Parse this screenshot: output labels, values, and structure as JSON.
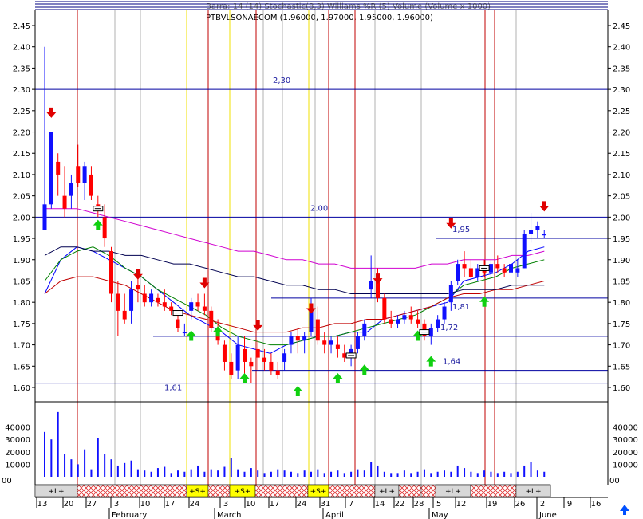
{
  "header": {
    "title": "PTBVLSONAECOM (1.96000, 1.97000, 1.95000, 1.96000)",
    "overlay_text": "Barra: 14 (14) Stochastic(8,3) Williams %R (5) Volume (Volume x 1000)"
  },
  "colors": {
    "bull_candle": "#1010ff",
    "bear_candle": "#ff0000",
    "vline_red": "#c00000",
    "vline_yellow": "#f0e000",
    "vline_gray": "#b0b0b0",
    "hline": "#0000a0",
    "ma_blue": "#0000ff",
    "ma_green": "#008000",
    "ma_red": "#c00000",
    "ma_navy": "#000050",
    "ma_magenta": "#d000d0",
    "arrow_up": "#10d010",
    "arrow_down": "#e00000",
    "signal_yellow": "#ffff00",
    "signal_hatch": "#e03030",
    "nav_arrow": "#0050ff"
  },
  "nav_icon": "arrow-up-icon",
  "chart_data": {
    "type": "candlestick",
    "price_axis": {
      "ylim": [
        1.6,
        2.45
      ],
      "ticks": [
        "1.60",
        "1.65",
        "1.70",
        "1.75",
        "1.80",
        "1.85",
        "1.90",
        "1.95",
        "2.00",
        "2.05",
        "2.10",
        "2.15",
        "2.20",
        "2.25",
        "2.30",
        "2.35",
        "2.40",
        "2.45"
      ]
    },
    "volume_axis": {
      "ticks": [
        "10000",
        "20000",
        "30000",
        "40000"
      ],
      "ylim": [
        0,
        50000
      ]
    },
    "volume_corner_label": "00",
    "x_day_ticks": [
      "13",
      "20",
      "27",
      "3",
      "10",
      "17",
      "24",
      "3",
      "10",
      "17",
      "24",
      "31",
      "7",
      "14",
      "22",
      "28",
      "5",
      "12",
      "19",
      "26",
      "2",
      "9",
      "16"
    ],
    "months": [
      "February",
      "March",
      "April",
      "May",
      "June"
    ],
    "annotations": [
      {
        "text": "2,30",
        "price": 2.3
      },
      {
        "text": "2.00",
        "price": 2.0
      },
      {
        "text": "1,95",
        "price": 1.95
      },
      {
        "text": "1,81",
        "price": 1.81
      },
      {
        "text": "1,72",
        "price": 1.72
      },
      {
        "text": "1,64",
        "price": 1.64
      },
      {
        "text": "1,61",
        "price": 1.61
      }
    ],
    "horizontal_levels": [
      2.3,
      2.0,
      1.95,
      1.85,
      1.81,
      1.72,
      1.64,
      1.61
    ],
    "candles": [
      [
        1.97,
        2.4,
        1.97,
        2.03
      ],
      [
        2.03,
        2.2,
        2.02,
        2.2
      ],
      [
        2.13,
        2.15,
        2.05,
        2.1
      ],
      [
        2.05,
        2.12,
        2.0,
        2.02
      ],
      [
        2.05,
        2.1,
        2.02,
        2.08
      ],
      [
        2.12,
        2.17,
        2.07,
        2.08
      ],
      [
        2.08,
        2.13,
        2.04,
        2.12
      ],
      [
        2.1,
        2.12,
        2.04,
        2.05
      ],
      [
        2.03,
        2.05,
        2.0,
        2.02
      ],
      [
        2.0,
        2.03,
        1.93,
        1.95
      ],
      [
        1.92,
        1.93,
        1.8,
        1.82
      ],
      [
        1.82,
        1.85,
        1.72,
        1.78
      ],
      [
        1.78,
        1.82,
        1.75,
        1.76
      ],
      [
        1.78,
        1.85,
        1.75,
        1.83
      ],
      [
        1.84,
        1.87,
        1.8,
        1.83
      ],
      [
        1.82,
        1.84,
        1.79,
        1.8
      ],
      [
        1.8,
        1.83,
        1.79,
        1.82
      ],
      [
        1.81,
        1.82,
        1.79,
        1.8
      ],
      [
        1.8,
        1.83,
        1.78,
        1.79
      ],
      [
        1.79,
        1.8,
        1.77,
        1.78
      ],
      [
        1.76,
        1.78,
        1.73,
        1.74
      ],
      [
        1.73,
        1.75,
        1.72,
        1.73
      ],
      [
        1.78,
        1.81,
        1.76,
        1.8
      ],
      [
        1.8,
        1.82,
        1.78,
        1.79
      ],
      [
        1.79,
        1.82,
        1.77,
        1.78
      ],
      [
        1.78,
        1.79,
        1.73,
        1.74
      ],
      [
        1.74,
        1.76,
        1.7,
        1.71
      ],
      [
        1.7,
        1.71,
        1.64,
        1.66
      ],
      [
        1.66,
        1.68,
        1.62,
        1.63
      ],
      [
        1.64,
        1.72,
        1.62,
        1.7
      ],
      [
        1.69,
        1.72,
        1.63,
        1.66
      ],
      [
        1.66,
        1.67,
        1.61,
        1.65
      ],
      [
        1.69,
        1.71,
        1.64,
        1.67
      ],
      [
        1.67,
        1.69,
        1.64,
        1.66
      ],
      [
        1.66,
        1.68,
        1.63,
        1.64
      ],
      [
        1.64,
        1.66,
        1.62,
        1.63
      ],
      [
        1.66,
        1.69,
        1.64,
        1.68
      ],
      [
        1.7,
        1.73,
        1.68,
        1.72
      ],
      [
        1.72,
        1.74,
        1.68,
        1.71
      ],
      [
        1.71,
        1.73,
        1.68,
        1.72
      ],
      [
        1.73,
        1.81,
        1.72,
        1.78
      ],
      [
        1.76,
        1.79,
        1.7,
        1.71
      ],
      [
        1.71,
        1.73,
        1.68,
        1.7
      ],
      [
        1.7,
        1.72,
        1.68,
        1.71
      ],
      [
        1.7,
        1.72,
        1.67,
        1.69
      ],
      [
        1.68,
        1.7,
        1.66,
        1.67
      ],
      [
        1.67,
        1.7,
        1.65,
        1.69
      ],
      [
        1.69,
        1.73,
        1.68,
        1.72
      ],
      [
        1.72,
        1.76,
        1.71,
        1.75
      ],
      [
        1.83,
        1.91,
        1.81,
        1.85
      ],
      [
        1.85,
        1.88,
        1.8,
        1.81
      ],
      [
        1.81,
        1.82,
        1.75,
        1.76
      ],
      [
        1.76,
        1.78,
        1.74,
        1.75
      ],
      [
        1.75,
        1.77,
        1.74,
        1.76
      ],
      [
        1.76,
        1.78,
        1.75,
        1.77
      ],
      [
        1.77,
        1.79,
        1.75,
        1.76
      ],
      [
        1.76,
        1.78,
        1.74,
        1.75
      ],
      [
        1.75,
        1.76,
        1.71,
        1.72
      ],
      [
        1.72,
        1.75,
        1.7,
        1.74
      ],
      [
        1.74,
        1.77,
        1.73,
        1.76
      ],
      [
        1.76,
        1.8,
        1.75,
        1.79
      ],
      [
        1.8,
        1.85,
        1.78,
        1.84
      ],
      [
        1.85,
        1.9,
        1.84,
        1.89
      ],
      [
        1.89,
        1.92,
        1.86,
        1.88
      ],
      [
        1.88,
        1.9,
        1.85,
        1.86
      ],
      [
        1.86,
        1.89,
        1.85,
        1.88
      ],
      [
        1.88,
        1.9,
        1.86,
        1.87
      ],
      [
        1.87,
        1.9,
        1.86,
        1.89
      ],
      [
        1.89,
        1.91,
        1.87,
        1.88
      ],
      [
        1.88,
        1.89,
        1.86,
        1.87
      ],
      [
        1.87,
        1.9,
        1.86,
        1.89
      ],
      [
        1.87,
        1.9,
        1.86,
        1.88
      ],
      [
        1.88,
        1.97,
        1.88,
        1.96
      ],
      [
        1.96,
        2.01,
        1.94,
        1.97
      ],
      [
        1.97,
        1.99,
        1.95,
        1.98
      ],
      [
        1.96,
        1.97,
        1.95,
        1.96
      ]
    ],
    "volumes": [
      36000,
      30000,
      52000,
      18000,
      14000,
      10000,
      22000,
      6000,
      31000,
      18000,
      14000,
      9000,
      11000,
      13000,
      6000,
      5000,
      4000,
      7000,
      8000,
      3000,
      5000,
      4000,
      6000,
      9000,
      4000,
      6000,
      5000,
      8000,
      15000,
      6000,
      4000,
      7000,
      5000,
      3000,
      4000,
      6000,
      5000,
      4000,
      3000,
      5000,
      4000,
      6000,
      3000,
      4000,
      5000,
      3000,
      4000,
      6000,
      5000,
      12000,
      9000,
      4000,
      3000,
      3000,
      5000,
      3000,
      4000,
      6000,
      3000,
      4000,
      5000,
      4000,
      9000,
      7000,
      4000,
      3000,
      5000,
      4000,
      3000,
      4000,
      3000,
      4000,
      9000,
      12000,
      5000,
      4000
    ],
    "arrows_up": [
      [
        8,
        2.02
      ],
      [
        22,
        1.76
      ],
      [
        26,
        1.77
      ],
      [
        30,
        1.66
      ],
      [
        38,
        1.63
      ],
      [
        44,
        1.66
      ],
      [
        48,
        1.68
      ],
      [
        56,
        1.76
      ],
      [
        58,
        1.7
      ],
      [
        66,
        1.84
      ]
    ],
    "arrows_down": [
      [
        1,
        2.22
      ],
      [
        14,
        1.84
      ],
      [
        24,
        1.82
      ],
      [
        32,
        1.72
      ],
      [
        40,
        1.76
      ],
      [
        50,
        1.83
      ],
      [
        61,
        1.96
      ],
      [
        75,
        2.0
      ]
    ],
    "box_markers": [
      [
        8,
        2.02
      ],
      [
        20,
        1.775
      ],
      [
        46,
        1.675
      ],
      [
        57,
        1.73
      ],
      [
        66,
        1.88
      ]
    ],
    "moving_averages": [
      {
        "color": "ma_blue",
        "values": [
          1.82,
          1.9,
          1.93,
          1.92,
          1.9,
          1.88,
          1.86,
          1.83,
          1.8,
          1.77,
          1.75,
          1.73,
          1.7,
          1.69,
          1.68,
          1.7,
          1.71,
          1.72,
          1.72,
          1.73,
          1.73,
          1.76,
          1.77,
          1.78,
          1.79,
          1.8,
          1.85,
          1.86,
          1.87,
          1.89,
          1.92,
          1.93
        ]
      },
      {
        "color": "ma_green",
        "values": [
          1.85,
          1.9,
          1.92,
          1.93,
          1.91,
          1.88,
          1.86,
          1.83,
          1.81,
          1.79,
          1.77,
          1.74,
          1.72,
          1.71,
          1.7,
          1.7,
          1.71,
          1.72,
          1.72,
          1.73,
          1.74,
          1.75,
          1.76,
          1.77,
          1.79,
          1.81,
          1.84,
          1.85,
          1.86,
          1.88,
          1.89,
          1.9
        ]
      },
      {
        "color": "ma_red",
        "values": [
          1.82,
          1.85,
          1.86,
          1.86,
          1.85,
          1.84,
          1.82,
          1.8,
          1.78,
          1.77,
          1.76,
          1.75,
          1.74,
          1.73,
          1.73,
          1.73,
          1.74,
          1.74,
          1.75,
          1.75,
          1.76,
          1.76,
          1.77,
          1.78,
          1.79,
          1.81,
          1.82,
          1.82,
          1.83,
          1.83,
          1.84,
          1.85
        ]
      },
      {
        "color": "ma_navy",
        "values": [
          1.91,
          1.93,
          1.93,
          1.92,
          1.92,
          1.91,
          1.91,
          1.9,
          1.89,
          1.89,
          1.88,
          1.87,
          1.86,
          1.86,
          1.85,
          1.84,
          1.84,
          1.83,
          1.83,
          1.82,
          1.82,
          1.82,
          1.82,
          1.82,
          1.82,
          1.82,
          1.83,
          1.83,
          1.83,
          1.84,
          1.84,
          1.84
        ]
      },
      {
        "color": "ma_magenta",
        "values": [
          2.02,
          2.02,
          2.02,
          2.01,
          2.0,
          1.99,
          1.98,
          1.97,
          1.96,
          1.95,
          1.94,
          1.93,
          1.92,
          1.92,
          1.91,
          1.9,
          1.9,
          1.89,
          1.89,
          1.88,
          1.88,
          1.88,
          1.88,
          1.88,
          1.89,
          1.89,
          1.9,
          1.9,
          1.9,
          1.91,
          1.91,
          1.92
        ]
      }
    ],
    "signal_bar": [
      {
        "label": "+L+",
        "kind": "gray"
      },
      {
        "label": "",
        "kind": "hatch"
      },
      {
        "label": "+S+",
        "kind": "yellow"
      },
      {
        "label": "",
        "kind": "hatch"
      },
      {
        "label": "+S+",
        "kind": "yellow"
      },
      {
        "label": "",
        "kind": "hatch"
      },
      {
        "label": "+S+",
        "kind": "yellow"
      },
      {
        "label": "",
        "kind": "hatch"
      },
      {
        "label": "+L+",
        "kind": "gray"
      },
      {
        "label": "",
        "kind": "hatch"
      },
      {
        "label": "+L+",
        "kind": "gray"
      },
      {
        "label": "",
        "kind": "hatch"
      },
      {
        "label": "+L+",
        "kind": "gray"
      }
    ]
  }
}
